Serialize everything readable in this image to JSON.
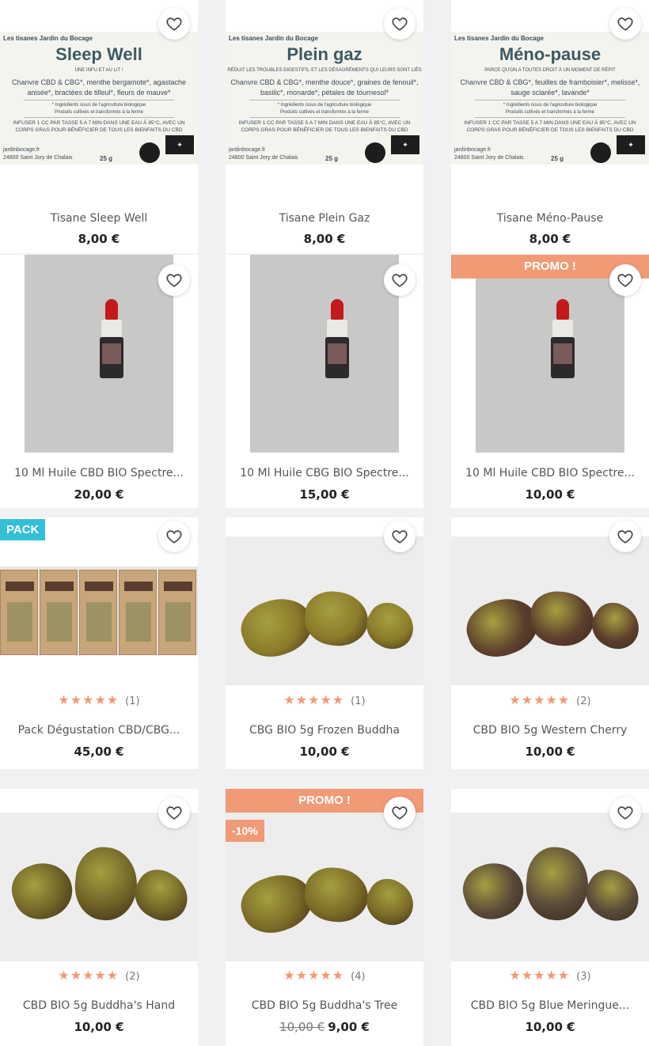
{
  "icons": {
    "wishlist": "heart-outline-icon",
    "rating": "star-icon"
  },
  "colors": {
    "accent": "#f09a76",
    "pack_badge": "#33bfd8",
    "star": "#ef9a74",
    "page_bg": "#f1f1f3"
  },
  "products": [
    {
      "name": "Tisane Sleep Well",
      "price": "8,00 €",
      "label": {
        "brand": "Les tisanes Jardin du Bocage",
        "title": "Sleep Well",
        "subtitle": "UNE INFU ET AU LIT !",
        "ingredients": "Chanvre CBD & CBG*, menthe bergamote*, agastache anisée*, bractées de tilleul*, fleurs de mauve*",
        "organic_note": "* Ingrédients issus de l'agriculture biologique",
        "farm_note": "Produits cultivés et transformés à la ferme",
        "instructions": "INFUSER 1 CC PAR TASSE 5 A 7 MIN DANS UNE EAU À 85°C, AVEC UN CORPS GRAS POUR BÉNÉFICIER DE TOUS LES BIENFAITS DU CBD",
        "site": "jardinbocage.fr",
        "address": "24800 Saint Jory de Chalais",
        "weight": "25 g"
      }
    },
    {
      "name": "Tisane Plein Gaz",
      "price": "8,00 €",
      "label": {
        "brand": "Les tisanes Jardin du Bocage",
        "title": "Plein gaz",
        "subtitle": "RÉDUIT LES TROUBLES DIGESTIFS, ET LES DÉSAGRÉMENTS QUI LEURS SONT LIÉS",
        "ingredients": "Chanvre CBD & CBG*, menthe douce*, graines de fenouil*, basilic*, monarde*, pétales de tournesol*",
        "organic_note": "* Ingrédients issus de l'agriculture biologique",
        "farm_note": "Produits cultivés et transformés à la ferme",
        "instructions": "INFUSER 1 CC PAR TASSE 5 A 7 MIN DANS UNE EAU À 85°C, AVEC UN CORPS GRAS POUR BÉNÉFICIER DE TOUS LES BIENFAITS DU CBD",
        "site": "jardinbocage.fr",
        "address": "24800 Saint Jory de Chalais",
        "weight": "25 g"
      }
    },
    {
      "name": "Tisane Méno-Pause",
      "price": "8,00 €",
      "label": {
        "brand": "Les tisanes Jardin du Bocage",
        "title": "Méno-pause",
        "subtitle": "PARCE QU'ON A TOUTES DROIT À UN MOMENT DE RÉPIT",
        "ingredients": "Chanvre CBD & CBG*, feuilles de framboisier*, melisse*, sauge sclarée*, lavande*",
        "organic_note": "* Ingrédients issus de l'agriculture biologique",
        "farm_note": "Produits cultivés et transformés à la ferme",
        "instructions": "INFUSER 1 CC PAR TASSE 5 A 7 MIN DANS UNE EAU À 85°C, AVEC UN CORPS GRAS POUR BÉNÉFICIER DE TOUS LES BIENFAITS DU CBD",
        "site": "jardinbocage.fr",
        "address": "24800 Saint Jory de Chalais",
        "weight": "25 g"
      }
    },
    {
      "name": "10 Ml Huile CBD BIO Spectre...",
      "price": "20,00 €"
    },
    {
      "name": "10 Ml Huile CBG BIO Spectre...",
      "price": "15,00 €"
    },
    {
      "name": "10 Ml Huile CBD BIO Spectre...",
      "price": "10,00 €",
      "badge": "PROMO !"
    },
    {
      "name": "Pack Dégustation CBD/CBG...",
      "price": "45,00 €",
      "badge": "PACK",
      "rating": 5,
      "reviews": "(1)"
    },
    {
      "name": "CBG BIO 5g Frozen Buddha",
      "price": "10,00 €",
      "rating": 5,
      "reviews": "(1)"
    },
    {
      "name": "CBD BIO 5g Western Cherry",
      "price": "10,00 €",
      "rating": 5,
      "reviews": "(2)"
    },
    {
      "name": "CBD BIO 5g Buddha's Hand",
      "price": "10,00 €",
      "rating": 5,
      "reviews": "(2)"
    },
    {
      "name": "CBD BIO 5g Buddha's Tree",
      "price": "9,00 €",
      "old_price": "10,00 €",
      "badge": "PROMO !",
      "discount": "-10%",
      "rating": 5,
      "reviews": "(4)"
    },
    {
      "name": "CBD BIO 5g Blue Meringue...",
      "price": "10,00 €",
      "rating": 5,
      "reviews": "(3)"
    }
  ]
}
